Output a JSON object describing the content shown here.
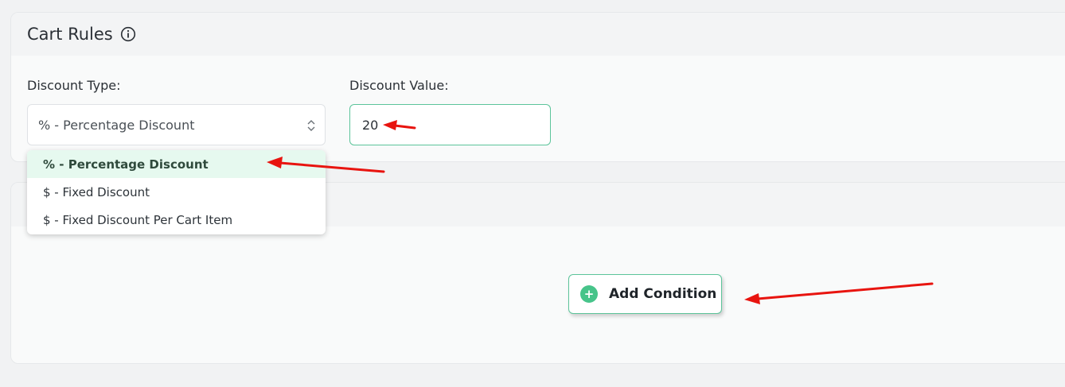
{
  "cart_rules": {
    "title": "Cart Rules",
    "info_icon": "info-circle-icon",
    "discount_type_label": "Discount Type:",
    "discount_type_selected": "% - Percentage Discount",
    "discount_value_label": "Discount Value:",
    "discount_value": "20"
  },
  "dropdown": {
    "options": [
      {
        "label": "% - Percentage Discount",
        "selected": true
      },
      {
        "label": "$ - Fixed Discount",
        "selected": false
      },
      {
        "label": "$ - Fixed Discount Per Cart Item",
        "selected": false
      }
    ]
  },
  "conditions": {
    "add_button_label": "Add Condition",
    "add_button_icon": "plus-circle-icon"
  },
  "colors": {
    "accent_green": "#47c48a",
    "border_green": "#5cc49a",
    "selected_bg": "#e6f9ef",
    "annotation_red": "#e8140f"
  }
}
